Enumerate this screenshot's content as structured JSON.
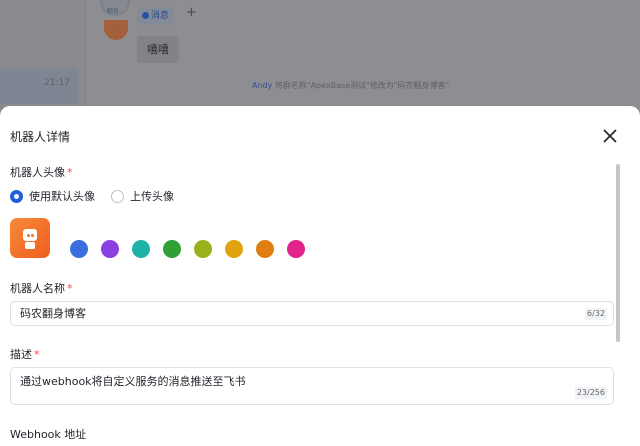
{
  "background": {
    "list_time": "21:17",
    "tag_label": "消息",
    "avatar_label": "翻身",
    "message": "嘻嘻",
    "system_user": "Andy",
    "system_text": " 将群名称\"ApexBase测试\"修改为\"码农翻身博客\""
  },
  "modal": {
    "title": "机器人详情",
    "avatar_label": "机器人头像",
    "radio_default": "使用默认头像",
    "radio_upload": "上传头像",
    "colors": [
      "#3b6fe0",
      "#8a3fe0",
      "#1fb3a8",
      "#2fa034",
      "#98b21d",
      "#e0a50e",
      "#e07f10",
      "#e0248c"
    ],
    "name_label": "机器人名称",
    "name_value": "码农翻身博客",
    "name_count": "6/32",
    "desc_label": "描述",
    "desc_value": "通过webhook将自定义服务的消息推送至飞书",
    "desc_count": "23/256",
    "webhook_label": "Webhook 地址",
    "required_mark": "*"
  }
}
